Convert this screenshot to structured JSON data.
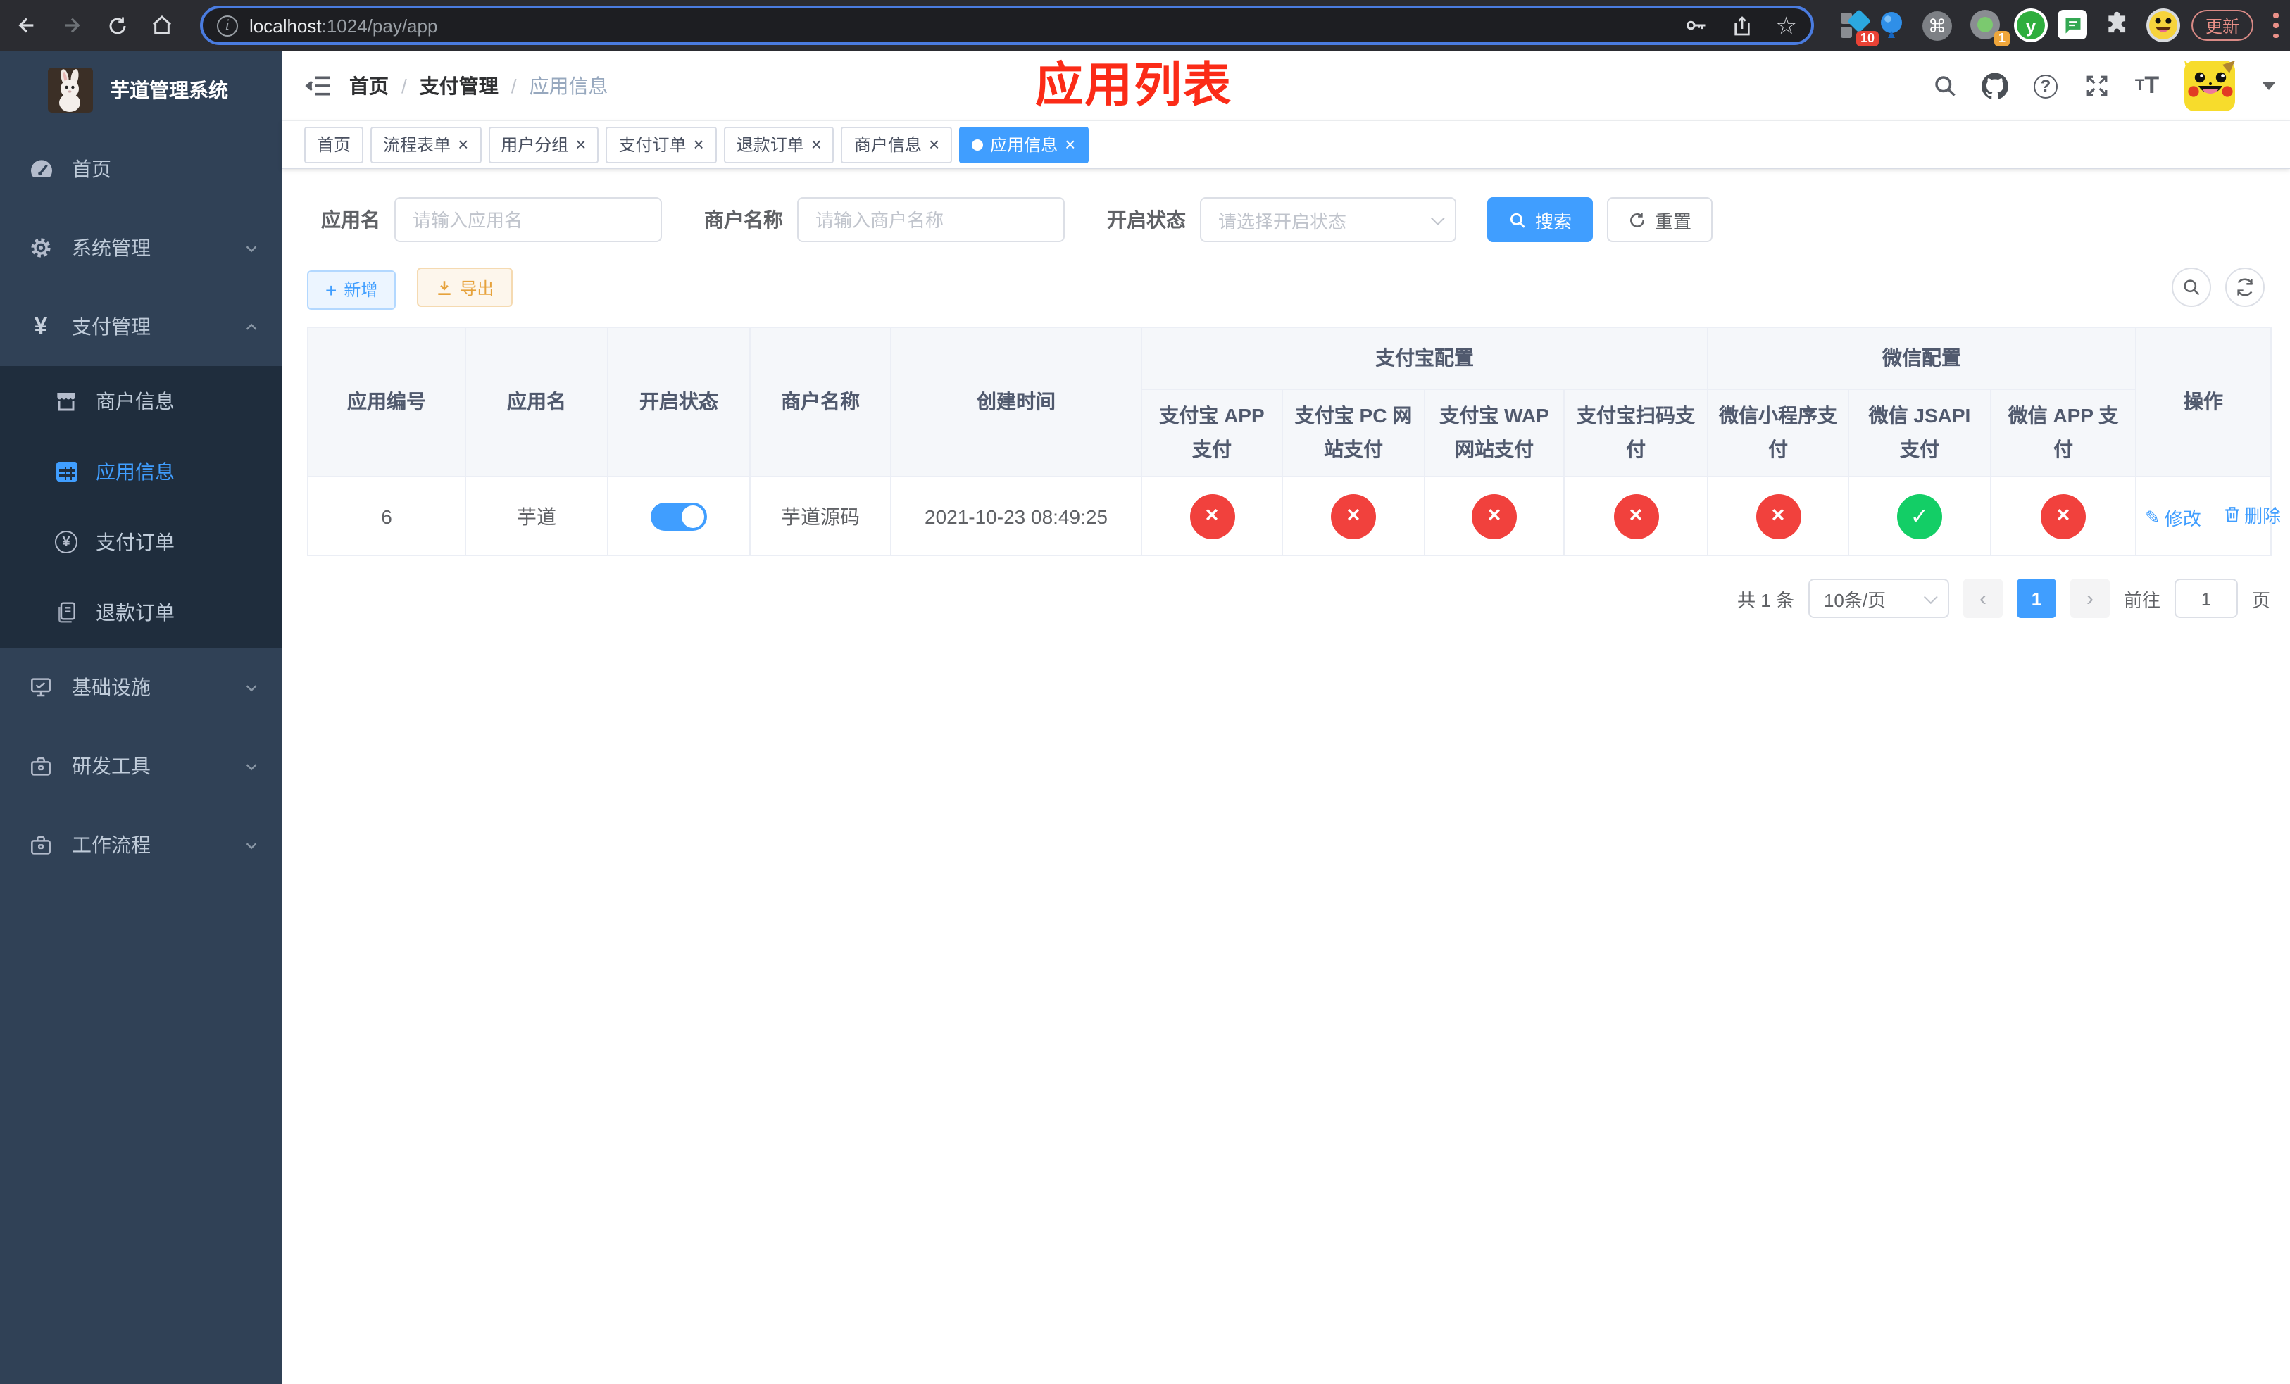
{
  "colors": {
    "accent": "#409eff",
    "success": "#13ce66",
    "danger": "#f1413d",
    "warning": "#e6a23c",
    "title_red": "#fb2b17",
    "sidebar_bg": "#304156",
    "submenu_bg": "#1f2d3d"
  },
  "icons": {
    "close": "×",
    "cross": "×",
    "check": "✓",
    "plus": "+",
    "yen": "¥",
    "question": "?",
    "info": "i",
    "command": "⌘",
    "slash": "/",
    "prev": "‹",
    "next": "›",
    "star": "☆",
    "edit_pen": "✎"
  },
  "browser": {
    "url_host": "localhost",
    "url_rest": ":1024/pay/app",
    "ext_badge_a": "10",
    "ext_badge_b": "1",
    "ext_y_label": "y",
    "update_label": "更新"
  },
  "sidebar": {
    "title": "芋道管理系统",
    "items": [
      {
        "label": "首页"
      },
      {
        "label": "系统管理"
      },
      {
        "label": "支付管理"
      },
      {
        "label": "基础设施"
      },
      {
        "label": "研发工具"
      },
      {
        "label": "工作流程"
      }
    ],
    "payment_children": [
      {
        "label": "商户信息"
      },
      {
        "label": "应用信息",
        "active": true
      },
      {
        "label": "支付订单"
      },
      {
        "label": "退款订单"
      }
    ]
  },
  "header": {
    "breadcrumb": [
      "首页",
      "支付管理",
      "应用信息"
    ],
    "overlay_title": "应用列表"
  },
  "tabs": [
    {
      "label": "首页",
      "closable": false
    },
    {
      "label": "流程表单",
      "closable": true
    },
    {
      "label": "用户分组",
      "closable": true
    },
    {
      "label": "支付订单",
      "closable": true
    },
    {
      "label": "退款订单",
      "closable": true
    },
    {
      "label": "商户信息",
      "closable": true
    },
    {
      "label": "应用信息",
      "closable": true,
      "active": true
    }
  ],
  "filters": {
    "app_name_label": "应用名",
    "app_name_placeholder": "请输入应用名",
    "merchant_label": "商户名称",
    "merchant_placeholder": "请输入商户名称",
    "status_label": "开启状态",
    "status_placeholder": "请选择开启状态",
    "search_label": "搜索",
    "reset_label": "重置"
  },
  "toolbar": {
    "add_label": "新增",
    "export_label": "导出"
  },
  "table": {
    "columns": [
      "应用编号",
      "应用名",
      "开启状态",
      "商户名称",
      "创建时间"
    ],
    "groups": [
      "支付宝配置",
      "微信配置"
    ],
    "subcolumns": [
      "支付宝 APP 支付",
      "支付宝 PC 网站支付",
      "支付宝 WAP 网站支付",
      "支付宝扫码支付",
      "微信小程序支付",
      "微信 JSAPI 支付",
      "微信 APP 支付"
    ],
    "op_label": "操作",
    "row": {
      "id": "6",
      "name": "芋道",
      "enabled": true,
      "merchant": "芋道源码",
      "created": "2021-10-23 08:49:25",
      "pay_status": [
        "no",
        "no",
        "no",
        "no",
        "no",
        "yes",
        "no"
      ],
      "edit_label": "修改",
      "delete_label": "删除"
    }
  },
  "pagination": {
    "total": "共 1 条",
    "page_size": "10条/页",
    "current_page": "1",
    "goto_prefix": "前往",
    "goto_value": "1",
    "goto_suffix": "页"
  }
}
